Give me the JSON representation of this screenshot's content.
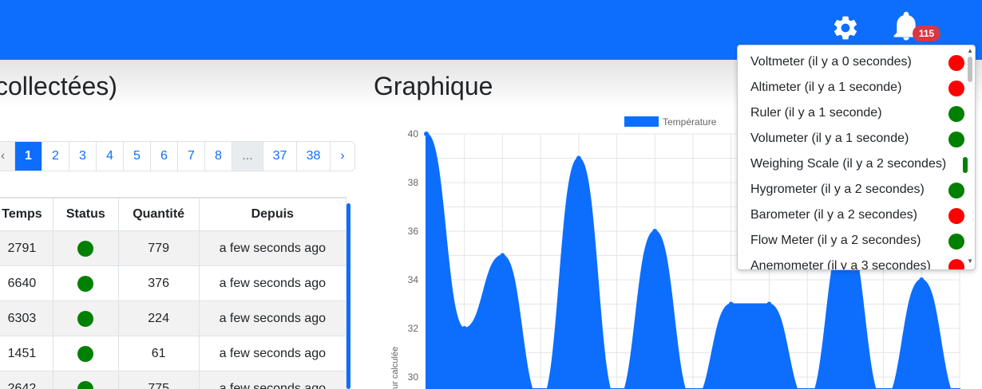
{
  "header": {
    "settings_icon": "gear-icon",
    "notifications_icon": "bell-icon",
    "notification_count": "115",
    "color": "#0d6efd"
  },
  "left": {
    "title": "collectées)",
    "pagination": {
      "prev": "‹",
      "pages": [
        "1",
        "2",
        "3",
        "4",
        "5",
        "6",
        "7",
        "8"
      ],
      "ellipsis": "...",
      "last_pages": [
        "37",
        "38"
      ],
      "next": "›",
      "active": "1"
    },
    "table": {
      "headers": [
        "Temps",
        "Status",
        "Quantité",
        "Depuis"
      ],
      "rows": [
        {
          "temps": "2791",
          "status": "green",
          "quantite": "779",
          "depuis": "a few seconds ago"
        },
        {
          "temps": "6640",
          "status": "green",
          "quantite": "376",
          "depuis": "a few seconds ago"
        },
        {
          "temps": "6303",
          "status": "green",
          "quantite": "224",
          "depuis": "a few seconds ago"
        },
        {
          "temps": "1451",
          "status": "green",
          "quantite": "61",
          "depuis": "a few seconds ago"
        },
        {
          "temps": "2642",
          "status": "green",
          "quantite": "775",
          "depuis": "a few seconds ago"
        }
      ]
    }
  },
  "right": {
    "title": "Graphique",
    "legend_label": "Température",
    "y_axis_label": "ur calculée"
  },
  "chart_data": {
    "type": "area",
    "series": [
      {
        "name": "Température",
        "values": [
          40,
          32,
          35,
          29,
          39,
          29,
          36,
          29,
          33,
          33,
          29,
          36,
          29,
          34,
          29
        ]
      }
    ],
    "ylim": [
      29,
      40
    ],
    "yticks": [
      "40",
      "38",
      "36",
      "34",
      "32",
      "30"
    ],
    "legend": "top",
    "grid": true,
    "color": "#0d6efd"
  },
  "notifications": {
    "items": [
      {
        "label": "Voltmeter (il y a 0 secondes)",
        "status": "red"
      },
      {
        "label": "Altimeter (il y a 1 seconde)",
        "status": "red"
      },
      {
        "label": "Ruler (il y a 1 seconde)",
        "status": "green"
      },
      {
        "label": "Volumeter (il y a 1 seconde)",
        "status": "green"
      },
      {
        "label": "Weighing Scale (il y a 2 secondes)",
        "status": "green"
      },
      {
        "label": "Hygrometer (il y a 2 secondes)",
        "status": "green"
      },
      {
        "label": "Barometer (il y a 2 secondes)",
        "status": "red"
      },
      {
        "label": "Flow Meter (il y a 2 secondes)",
        "status": "green"
      },
      {
        "label": "Anemometer (il y a 3 secondes)",
        "status": "red"
      }
    ],
    "colors": {
      "red": "#ff0000",
      "green": "#008000"
    }
  }
}
